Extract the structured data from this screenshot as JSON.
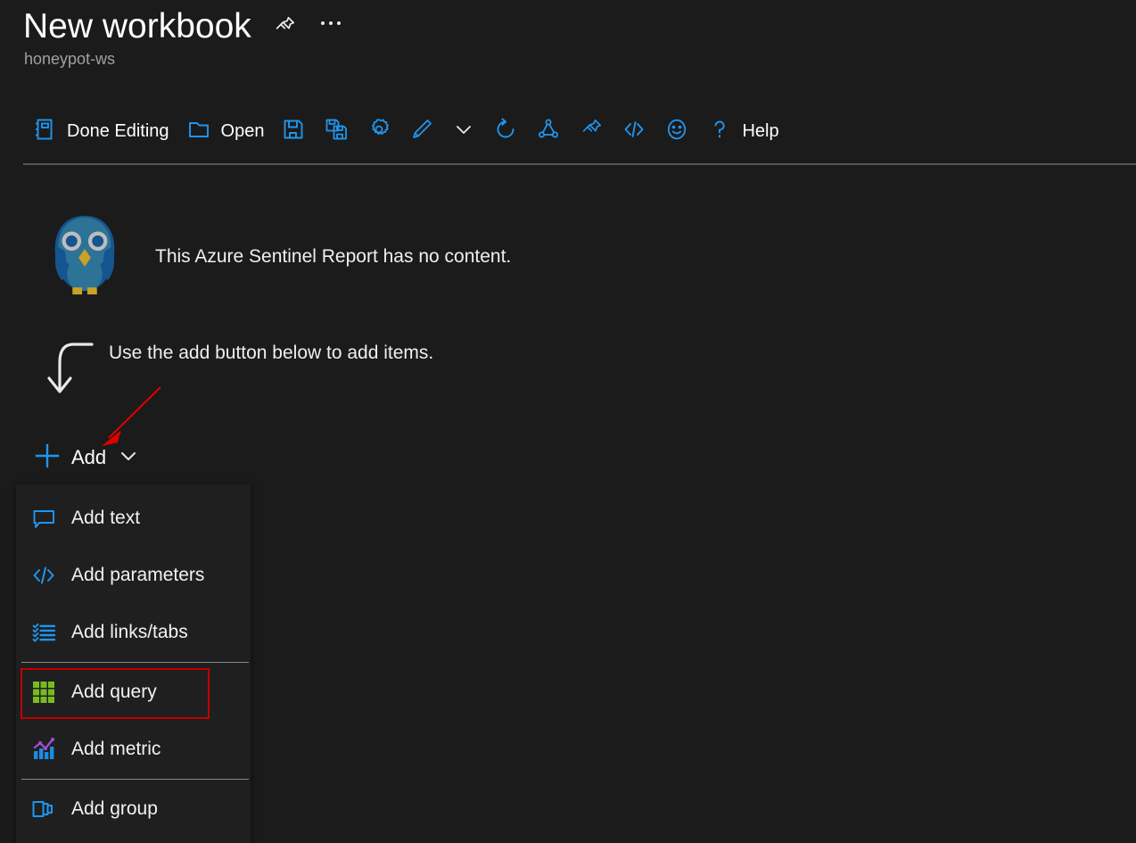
{
  "header": {
    "title": "New workbook",
    "subtitle": "honeypot-ws",
    "pin_icon": "pin-icon",
    "more_icon": "ellipsis-icon"
  },
  "toolbar": {
    "items": [
      {
        "label": "Done Editing",
        "icon": "edit-done-icon"
      },
      {
        "label": "Open",
        "icon": "open-folder-icon"
      },
      {
        "label": "",
        "icon": "save-icon"
      },
      {
        "label": "",
        "icon": "save-as-icon"
      },
      {
        "label": "",
        "icon": "gear-icon"
      },
      {
        "label": "",
        "icon": "pencil-icon"
      },
      {
        "label": "",
        "icon": "chevron-down-icon"
      },
      {
        "label": "",
        "icon": "refresh-icon"
      },
      {
        "label": "",
        "icon": "share-icon"
      },
      {
        "label": "",
        "icon": "pin-icon"
      },
      {
        "label": "",
        "icon": "code-icon"
      },
      {
        "label": "",
        "icon": "smiley-icon"
      },
      {
        "label": "Help",
        "icon": "question-mark-icon"
      }
    ]
  },
  "empty_state": {
    "illustration": "owl-icon",
    "message": "This Azure Sentinel Report has no content.",
    "hint": "Use the add button below to add items.",
    "hint_arrow_icon": "curved-down-arrow-icon"
  },
  "add_button": {
    "label": "Add",
    "plus_icon": "plus-icon",
    "chevron_icon": "chevron-down-icon"
  },
  "add_menu": {
    "items": [
      {
        "label": "Add text",
        "icon": "comment-bubble-icon",
        "separator_after": false,
        "highlighted": false
      },
      {
        "label": "Add parameters",
        "icon": "code-icon",
        "separator_after": false,
        "highlighted": false
      },
      {
        "label": "Add links/tabs",
        "icon": "checklist-icon",
        "separator_after": true,
        "highlighted": false
      },
      {
        "label": "Add query",
        "icon": "grid-icon",
        "separator_after": false,
        "highlighted": true
      },
      {
        "label": "Add metric",
        "icon": "chart-metric-icon",
        "separator_after": true,
        "highlighted": false
      },
      {
        "label": "Add group",
        "icon": "group-panels-icon",
        "separator_after": false,
        "highlighted": false
      }
    ]
  },
  "annotation": {
    "arrow_icon": "red-pointer-arrow",
    "highlight_color": "#C00000",
    "arrow_color": "#E00000"
  },
  "colors": {
    "background": "#1B1B1B",
    "menu_background": "#1F1F1F",
    "accent_blue": "#1F96F0",
    "text": "#FFFFFF",
    "subtitle": "#A0A0A0",
    "query_green": "#76BC21",
    "metric_purple": "#9B4FD4"
  }
}
